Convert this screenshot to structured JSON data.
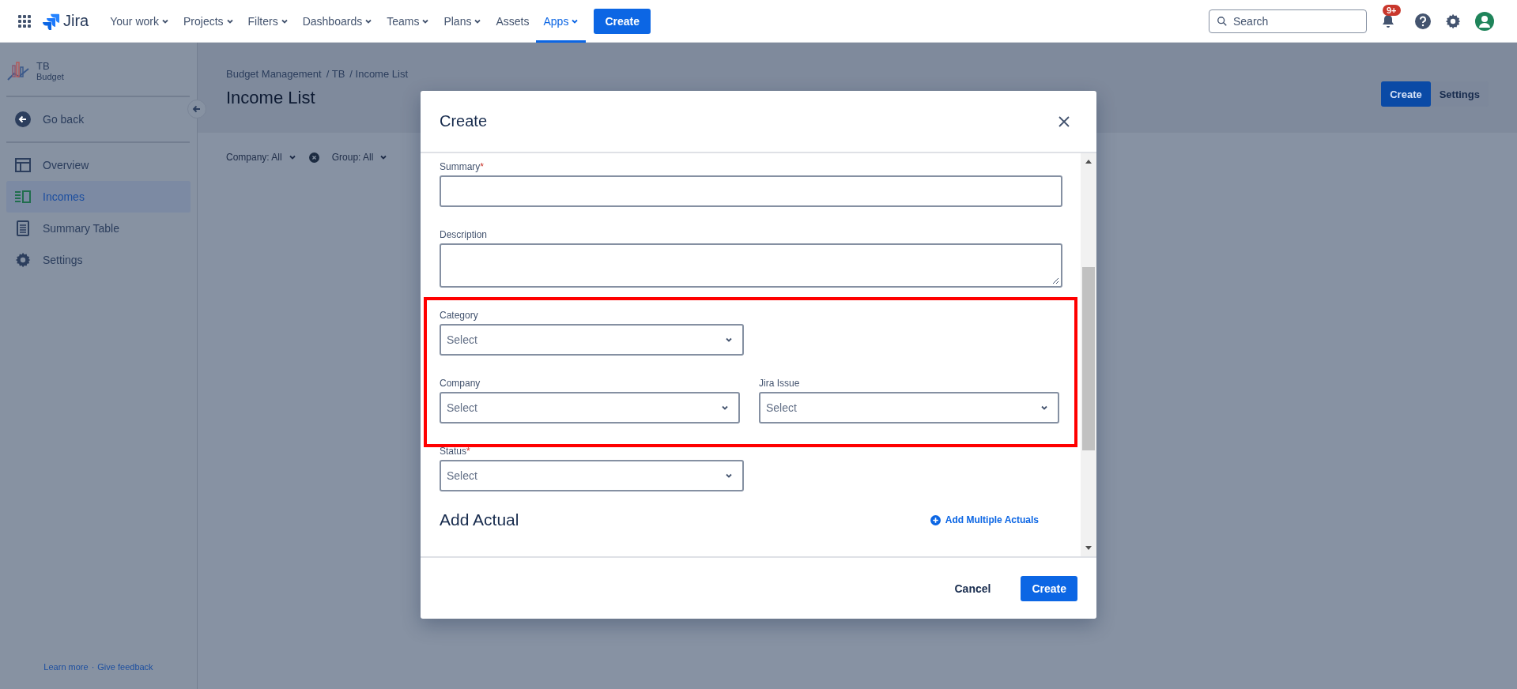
{
  "topbar": {
    "logo": "Jira",
    "nav": [
      {
        "label": "Your work",
        "dropdown": true,
        "selected": false
      },
      {
        "label": "Projects",
        "dropdown": true,
        "selected": false
      },
      {
        "label": "Filters",
        "dropdown": true,
        "selected": false
      },
      {
        "label": "Dashboards",
        "dropdown": true,
        "selected": false
      },
      {
        "label": "Teams",
        "dropdown": true,
        "selected": false
      },
      {
        "label": "Plans",
        "dropdown": true,
        "selected": false
      },
      {
        "label": "Assets",
        "dropdown": false,
        "selected": false
      },
      {
        "label": "Apps",
        "dropdown": true,
        "selected": true
      }
    ],
    "create": "Create",
    "search": {
      "placeholder": "Search"
    },
    "notification_badge": "9+"
  },
  "sidebar": {
    "project": {
      "name": "TB",
      "type": "Budget"
    },
    "items": [
      {
        "kind": "back",
        "label": "Go back",
        "selected": false
      },
      {
        "kind": "overview",
        "label": "Overview",
        "selected": false
      },
      {
        "kind": "incomes",
        "label": "Incomes",
        "selected": true
      },
      {
        "kind": "table",
        "label": "Summary Table",
        "selected": false
      },
      {
        "kind": "settings",
        "label": "Settings",
        "selected": false
      }
    ],
    "footer": {
      "links": [
        "Learn more",
        "Give feedback"
      ],
      "separator": "·"
    }
  },
  "page": {
    "breadcrumbs": [
      "Budget Management",
      "/ TB",
      "/ Income List"
    ],
    "title": "Income List",
    "actions": [
      {
        "label": "Create",
        "primary": true
      },
      {
        "label": "Settings",
        "primary": false
      }
    ],
    "filters": [
      {
        "label": "Company: All",
        "clearable": true
      },
      {
        "label": "Group: All",
        "clearable": false
      }
    ]
  },
  "dialog": {
    "title": "Create",
    "required_mark": "*",
    "rows": [
      {
        "fields": [
          {
            "kind": "text",
            "label": "Summary",
            "required": true
          }
        ]
      },
      {
        "fields": [
          {
            "kind": "textarea",
            "label": "Description",
            "required": false
          }
        ]
      },
      {
        "fields": [
          {
            "kind": "select",
            "label": "Category",
            "required": false,
            "placeholder": "Select"
          }
        ]
      },
      {
        "fields": [
          {
            "kind": "select",
            "label": "Company",
            "required": false,
            "placeholder": "Select"
          },
          {
            "kind": "select",
            "label": "Jira Issue",
            "required": false,
            "placeholder": "Select"
          }
        ]
      },
      {
        "fields": [
          {
            "kind": "select",
            "label": "Status",
            "required": true,
            "placeholder": "Select"
          }
        ]
      }
    ],
    "section": {
      "heading": "Add Actual",
      "link": "Add Multiple Actuals"
    },
    "buttons": [
      {
        "label": "Cancel",
        "primary": false
      },
      {
        "label": "Create",
        "primary": true
      }
    ]
  }
}
